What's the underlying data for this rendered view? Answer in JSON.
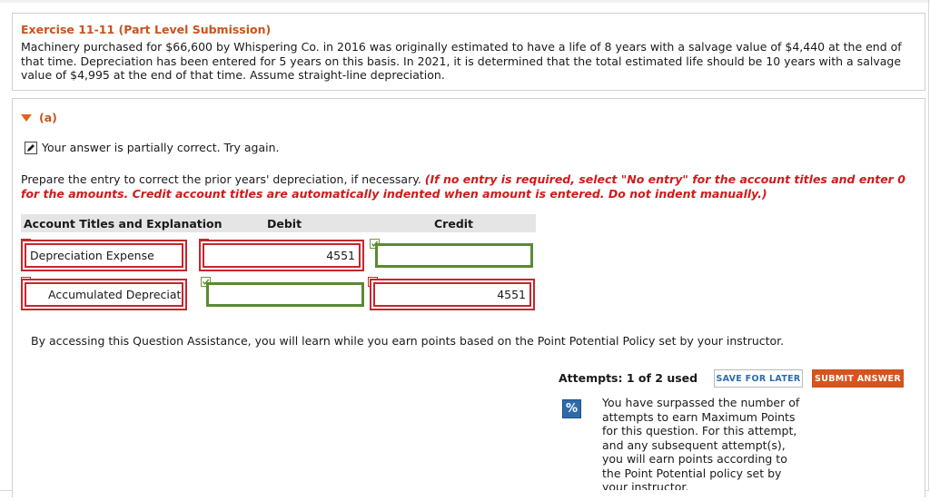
{
  "exercise": {
    "title": "Exercise 11-11 (Part Level Submission)",
    "problem_text": "Machinery purchased for $66,600 by Whispering Co. in 2016 was originally estimated to have a life of 8 years with a salvage value of $4,440 at the end of that time. Depreciation has been entered for 5 years on this basis. In 2021, it is determined that the total estimated life should be 10 years with a salvage value of $4,995 at the end of that time. Assume straight-line depreciation."
  },
  "part": {
    "label": "(a)",
    "status": "Your answer is partially correct.  Try again.",
    "instruction_plain": "Prepare the entry to correct the prior years' depreciation, if necessary. ",
    "instruction_red": "(If no entry is required, select \"No entry\" for the account titles and enter 0 for the amounts. Credit account titles are automatically indented when amount is entered. Do not indent manually.)"
  },
  "table": {
    "headers": {
      "account": "Account Titles and Explanation",
      "debit": "Debit",
      "credit": "Credit"
    },
    "rows": [
      {
        "account": "Depreciation Expense",
        "debit": "4551",
        "credit": ""
      },
      {
        "account": "Accumulated Depreciati",
        "debit": "",
        "credit": "4551"
      }
    ]
  },
  "assistance_text": "By accessing this Question Assistance, you will learn while you earn points based on the Point Potential Policy set by your instructor.",
  "attempts_label": "Attempts: 1 of 2 used",
  "buttons": {
    "save": "SAVE FOR LATER",
    "submit": "SUBMIT ANSWER"
  },
  "policy": {
    "icon": "%",
    "text": "You have surpassed the number of attempts to earn Maximum Points for this question. For this attempt, and any subsequent attempt(s), you will earn points according to the Point Potential policy set by your instructor."
  },
  "colors": {
    "accent": "#c9531c",
    "error": "#c6262e",
    "correct": "#5a8a32",
    "link": "#2b6cb0"
  }
}
